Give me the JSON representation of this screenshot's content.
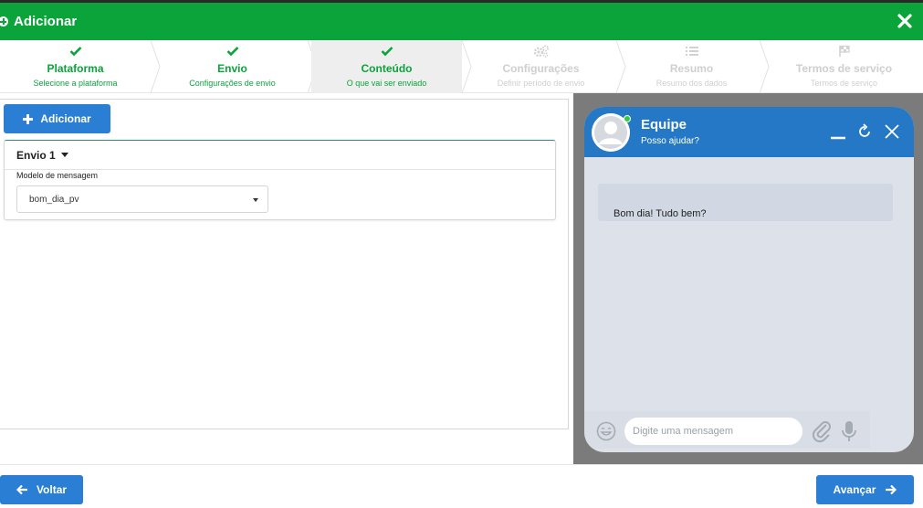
{
  "modal": {
    "title": "Adicionar"
  },
  "steps": [
    {
      "title": "Plataforma",
      "subtitle": "Selecione a plataforma",
      "status": "done",
      "icon": "check-icon"
    },
    {
      "title": "Envio",
      "subtitle": "Configurações de envio",
      "status": "done",
      "icon": "check-icon"
    },
    {
      "title": "Conteúdo",
      "subtitle": "O que vai ser enviado",
      "status": "active",
      "icon": "check-icon"
    },
    {
      "title": "Configurações",
      "subtitle": "Definir período de envio",
      "status": "todo",
      "icon": "gears-icon"
    },
    {
      "title": "Resumo",
      "subtitle": "Resumo dos dados",
      "status": "todo",
      "icon": "list-icon"
    },
    {
      "title": "Termos de serviço",
      "subtitle": "Termos de serviço",
      "status": "todo",
      "icon": "flag-icon"
    }
  ],
  "content": {
    "add_button": "Adicionar",
    "envio_title": "Envio 1",
    "template_label": "Modelo de mensagem",
    "template_value": "bom_dia_pv"
  },
  "chat": {
    "name": "Equipe",
    "subtitle": "Posso ajudar?",
    "message": "Bom dia! Tudo bem?",
    "input_placeholder": "Digite uma mensagem"
  },
  "footer": {
    "back_label": "Voltar",
    "next_label": "Avançar"
  },
  "colors": {
    "header_green": "#0aa43a",
    "primary_blue": "#2a7fd4",
    "chat_header_blue": "#2478c5",
    "online_green": "#33cc33"
  }
}
